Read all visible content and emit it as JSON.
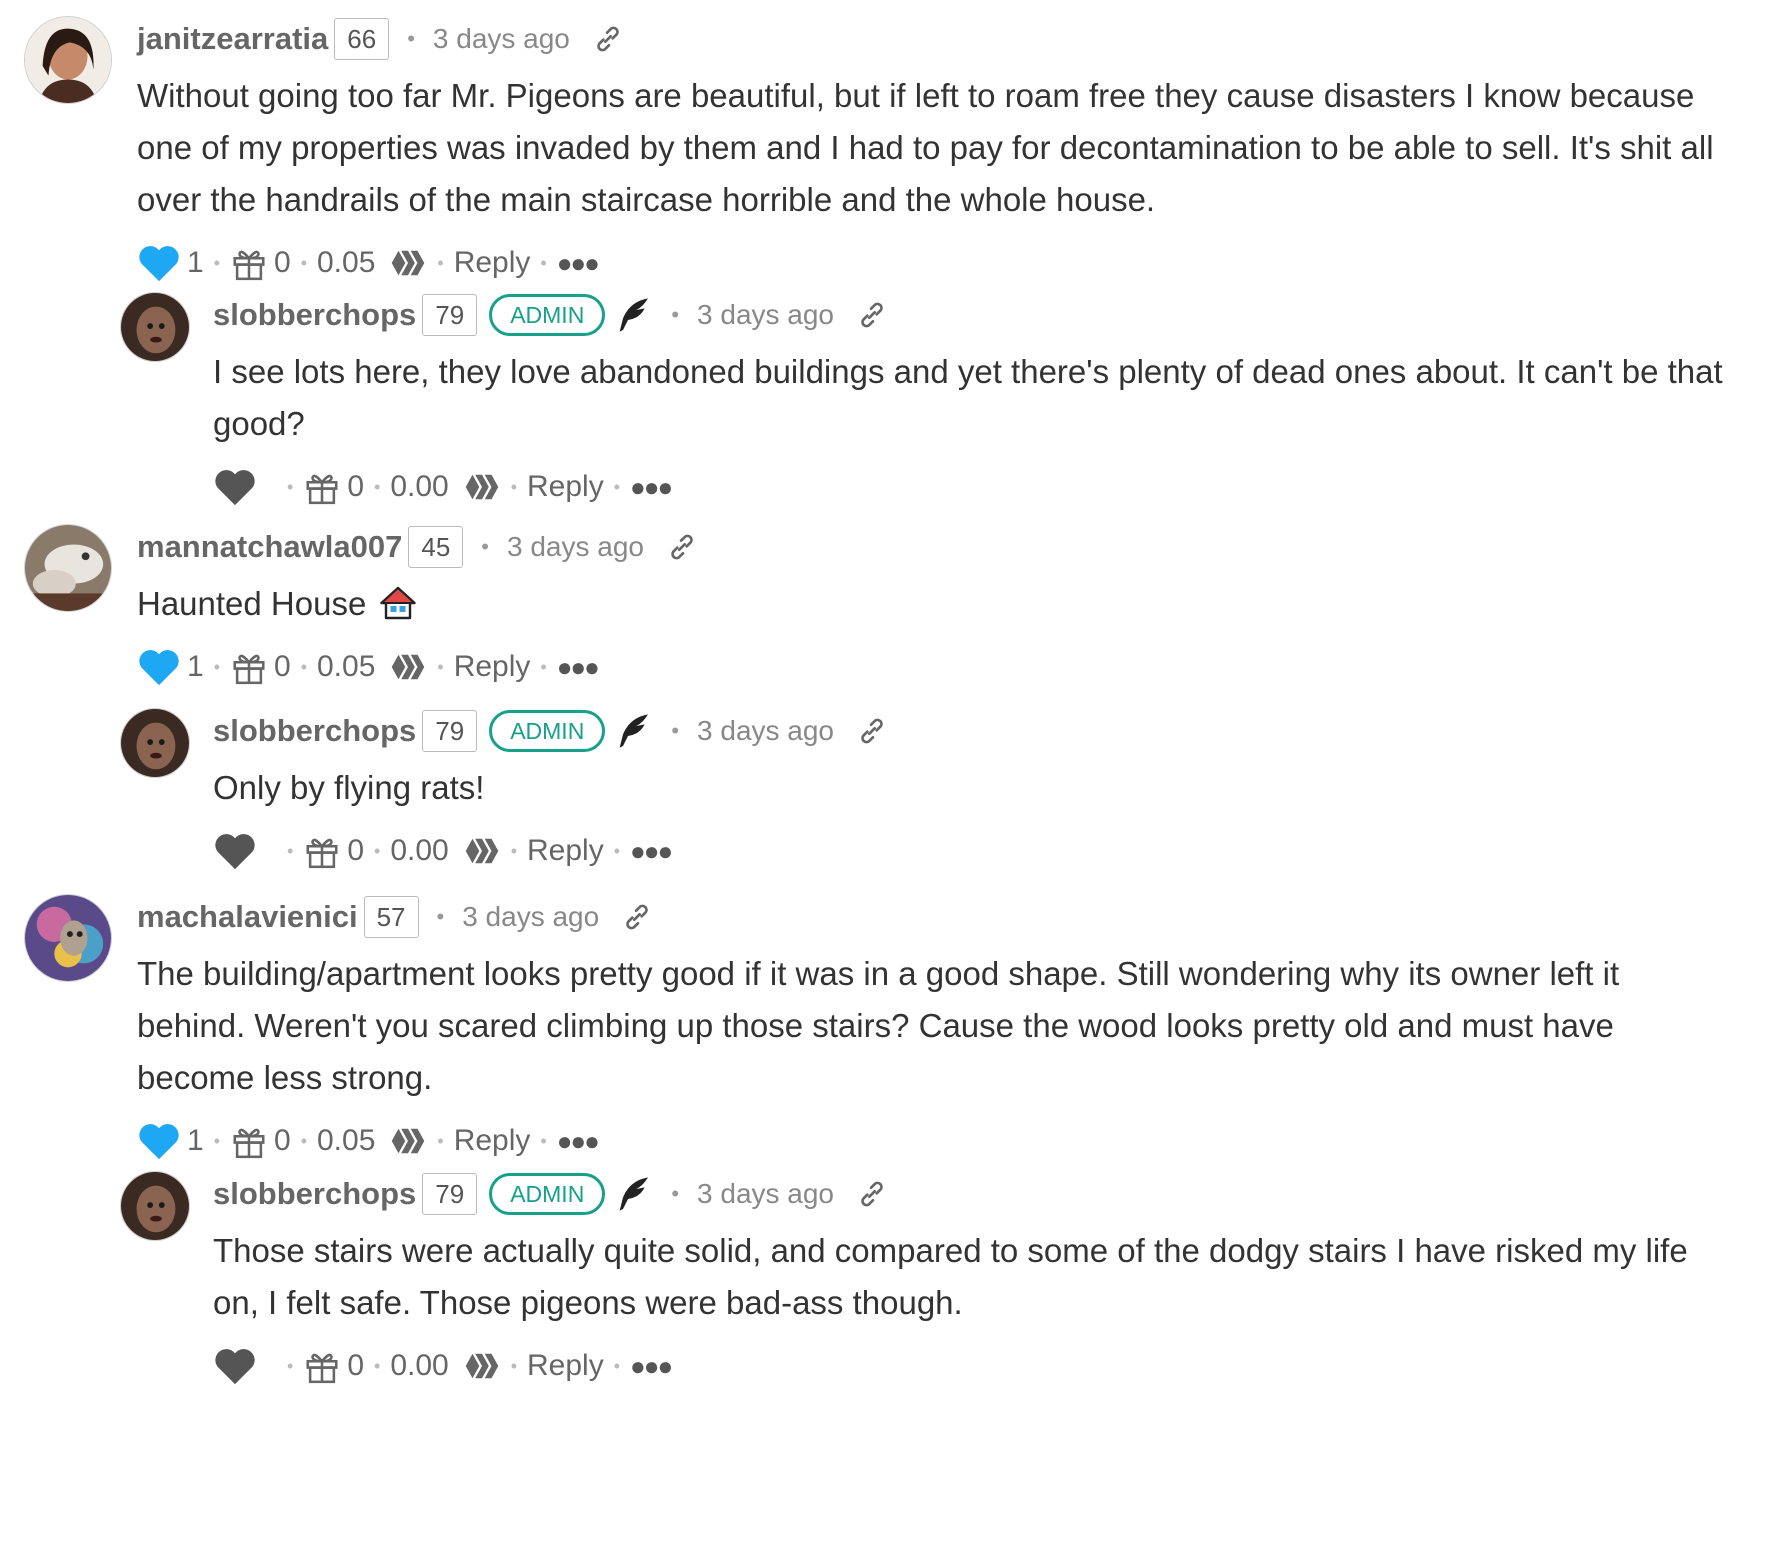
{
  "comments": [
    {
      "author": "janitzearratia",
      "rep": "66",
      "time": "3 days ago",
      "text": "Without going too far Mr. Pigeons are beautiful, but if left to roam free they cause disasters I know because one of my properties was invaded by them and I had to pay for decontamination to be able to sell. It's shit all over the handrails of the main staircase horrible and the whole house.",
      "votes": "1",
      "tips": "0",
      "payout": "0.05",
      "reply_label": "Reply",
      "liked": true
    },
    {
      "author": "slobberchops",
      "rep": "79",
      "badge": "ADMIN",
      "time": "3 days ago",
      "text": "I see lots here, they love abandoned buildings and yet there's plenty of dead ones about. It can't be that good?",
      "votes": "",
      "tips": "0",
      "payout": "0.00",
      "reply_label": "Reply",
      "liked": false
    },
    {
      "author": "mannatchawla007",
      "rep": "45",
      "time": "3 days ago",
      "text": "Haunted House",
      "votes": "1",
      "tips": "0",
      "payout": "0.05",
      "reply_label": "Reply",
      "liked": true
    },
    {
      "author": "slobberchops",
      "rep": "79",
      "badge": "ADMIN",
      "time": "3 days ago",
      "text": "Only by flying rats!",
      "votes": "",
      "tips": "0",
      "payout": "0.00",
      "reply_label": "Reply",
      "liked": false
    },
    {
      "author": "machalavienici",
      "rep": "57",
      "time": "3 days ago",
      "text": "The building/apartment looks pretty good if it was in a good shape. Still wondering why its owner left it behind. Weren't you scared climbing up those stairs? Cause the wood looks pretty old and must have become less strong.",
      "votes": "1",
      "tips": "0",
      "payout": "0.05",
      "reply_label": "Reply",
      "liked": true
    },
    {
      "author": "slobberchops",
      "rep": "79",
      "badge": "ADMIN",
      "time": "3 days ago",
      "text": "Those stairs were actually quite solid, and compared to some of the dodgy stairs I have risked my life on, I felt safe. Those pigeons were bad-ass though.",
      "votes": "",
      "tips": "0",
      "payout": "0.00",
      "reply_label": "Reply",
      "liked": false
    }
  ],
  "colors": {
    "liked_heart": "#1ea7f2",
    "unliked_heart": "#555555",
    "admin_badge": "#17a08a"
  },
  "icons": [
    "heart-icon",
    "gift-icon",
    "hive-icon",
    "link-icon",
    "feather-icon",
    "more-icon",
    "house-emoji"
  ]
}
